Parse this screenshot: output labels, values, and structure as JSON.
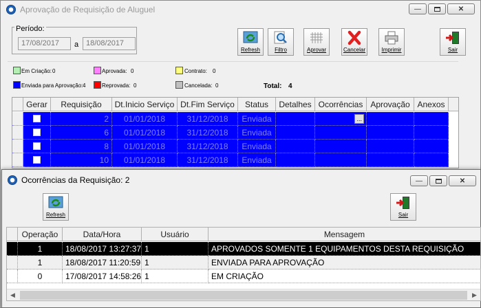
{
  "main": {
    "title": "Aprovação de Requisição de Aluguel",
    "periodo_label": "Período:",
    "date_from": "17/08/2017",
    "date_sep": "a",
    "date_to": "18/08/2017",
    "toolbar": {
      "refresh": "Refresh",
      "filtro": "Filtro",
      "aprovar": "Aprovar",
      "cancelar": "Cancelar",
      "imprimir": "Imprimir",
      "sair": "Sair"
    },
    "legend": {
      "em_criacao": "Em Criação:",
      "em_criacao_count": "0",
      "aprovada": "Aprovada:",
      "aprovada_count": "0",
      "contrato": "Contrato:",
      "contrato_count": "0",
      "enviada": "Enviada para Aprovação:",
      "enviada_count": "4",
      "reprovada": "Reprovada:",
      "reprovada_count": "0",
      "cancelada": "Cancelada:",
      "cancelada_count": "0",
      "total_label": "Total:",
      "total": "4"
    },
    "columns": [
      "Gerar",
      "Requisição",
      "Dt.Inicio Serviço",
      "Dt.Fim Serviço",
      "Status",
      "Detalhes",
      "Ocorrências",
      "Aprovação",
      "Anexos"
    ],
    "rows": [
      {
        "req": "2",
        "inicio": "01/01/2018",
        "fim": "31/12/2018",
        "status": "Enviada"
      },
      {
        "req": "6",
        "inicio": "01/01/2018",
        "fim": "31/12/2018",
        "status": "Enviada"
      },
      {
        "req": "8",
        "inicio": "01/01/2018",
        "fim": "31/12/2018",
        "status": "Enviada"
      },
      {
        "req": "10",
        "inicio": "01/01/2018",
        "fim": "31/12/2018",
        "status": "Enviada"
      }
    ],
    "ellipsis": "..."
  },
  "dialog": {
    "title": "Ocorrências da Requisição: 2",
    "refresh": "Refresh",
    "sair": "Sair",
    "columns": [
      "Operação",
      "Data/Hora",
      "Usuário",
      "Mensagem"
    ],
    "rows": [
      {
        "op": "1",
        "dt": "18/08/2017 13:27:37",
        "user": "1",
        "msg": "APROVADOS SOMENTE 1 EQUIPAMENTOS DESTA REQUISIÇÃO"
      },
      {
        "op": "1",
        "dt": "18/08/2017 11:20:59",
        "user": "1",
        "msg": "ENVIADA PARA APROVAÇÃO"
      },
      {
        "op": "0",
        "dt": "17/08/2017 14:58:26",
        "user": "1",
        "msg": "EM CRIAÇÃO"
      }
    ]
  },
  "colors": {
    "em_criacao": "#b4f0b4",
    "aprovada": "#ff80ff",
    "contrato": "#ffff80",
    "enviada": "#0000ff",
    "reprovada": "#ff0000",
    "cancelada": "#c0c0c0"
  }
}
